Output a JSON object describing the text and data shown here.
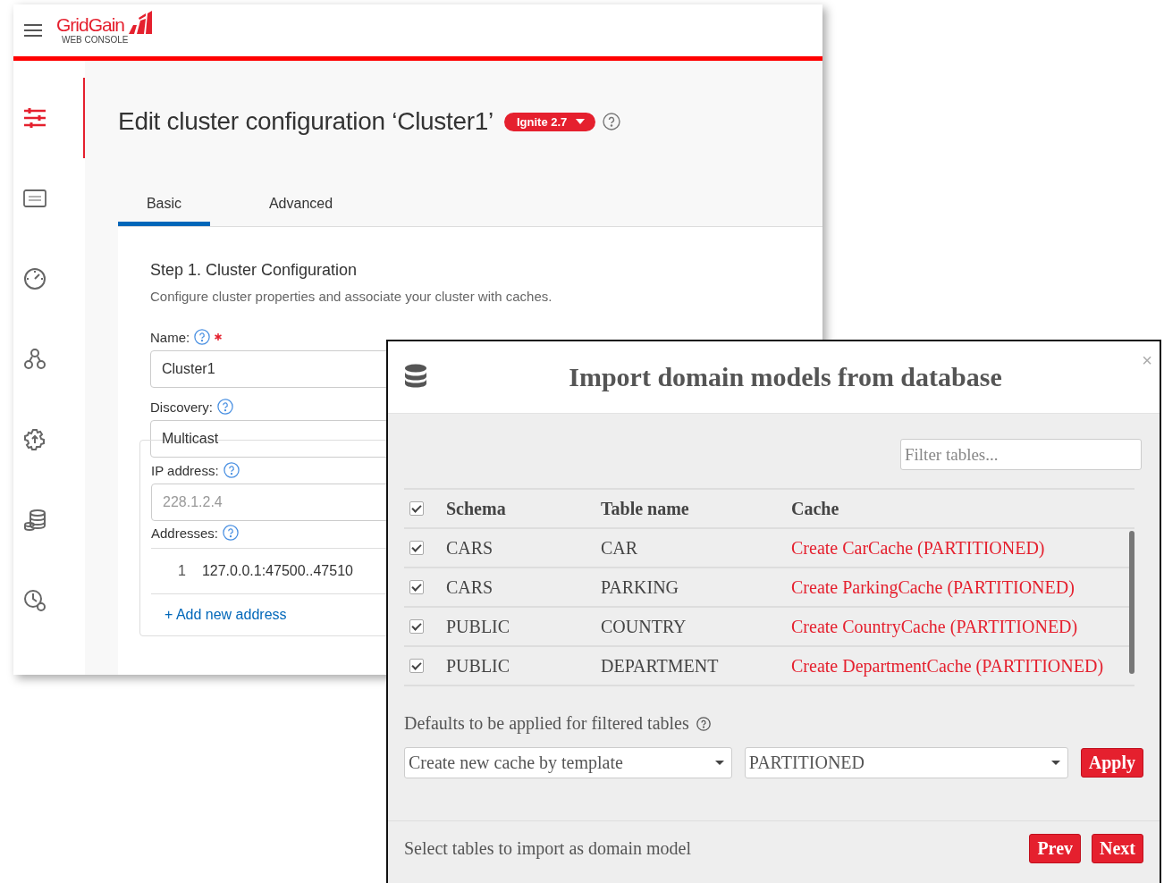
{
  "app": {
    "logo_name": "GridGain",
    "logo_subtitle": "WEB CONSOLE"
  },
  "sidebar": {
    "items": [
      {
        "selected": true
      },
      {
        "selected": false
      },
      {
        "selected": false
      },
      {
        "selected": false
      },
      {
        "selected": false
      },
      {
        "selected": false
      },
      {
        "selected": false
      }
    ]
  },
  "page": {
    "title": "Edit cluster configuration ‘Cluster1’",
    "version_badge": "Ignite 2.7"
  },
  "tabs": [
    {
      "label": "Basic",
      "selected": true
    },
    {
      "label": "Advanced",
      "selected": false
    }
  ],
  "step": {
    "title": "Step 1. Cluster Configuration",
    "description": "Configure cluster properties and associate your cluster with caches."
  },
  "form": {
    "name": {
      "label": "Name:",
      "required": true,
      "value": "Cluster1"
    },
    "discovery": {
      "label": "Discovery:",
      "value": "Multicast"
    },
    "ip_address": {
      "label": "IP address:",
      "placeholder": "228.1.2.4"
    },
    "addresses": {
      "label": "Addresses:",
      "items": [
        {
          "index": "1",
          "value": "127.0.0.1:47500..47510"
        }
      ],
      "add_link": "+ Add new address"
    }
  },
  "dialog": {
    "title": "Import domain models from database",
    "close": "×",
    "filter": {
      "placeholder": "Filter tables..."
    },
    "table": {
      "all_checked": true,
      "columns": [
        "Schema",
        "Table name",
        "Cache"
      ],
      "rows": [
        {
          "checked": true,
          "schema": "CARS",
          "table": "CAR",
          "cache": "Create CarCache (PARTITIONED)"
        },
        {
          "checked": true,
          "schema": "CARS",
          "table": "PARKING",
          "cache": "Create ParkingCache (PARTITIONED)"
        },
        {
          "checked": true,
          "schema": "PUBLIC",
          "table": "COUNTRY",
          "cache": "Create CountryCache (PARTITIONED)"
        },
        {
          "checked": true,
          "schema": "PUBLIC",
          "table": "DEPARTMENT",
          "cache": "Create DepartmentCache (PARTITIONED)"
        }
      ]
    },
    "defaults_label": "Defaults to be applied for filtered tables",
    "template_select": "Create new cache by template",
    "mode_select": "PARTITIONED",
    "apply": "Apply",
    "footer_text": "Select tables to import as domain model",
    "prev": "Prev",
    "next": "Next"
  }
}
